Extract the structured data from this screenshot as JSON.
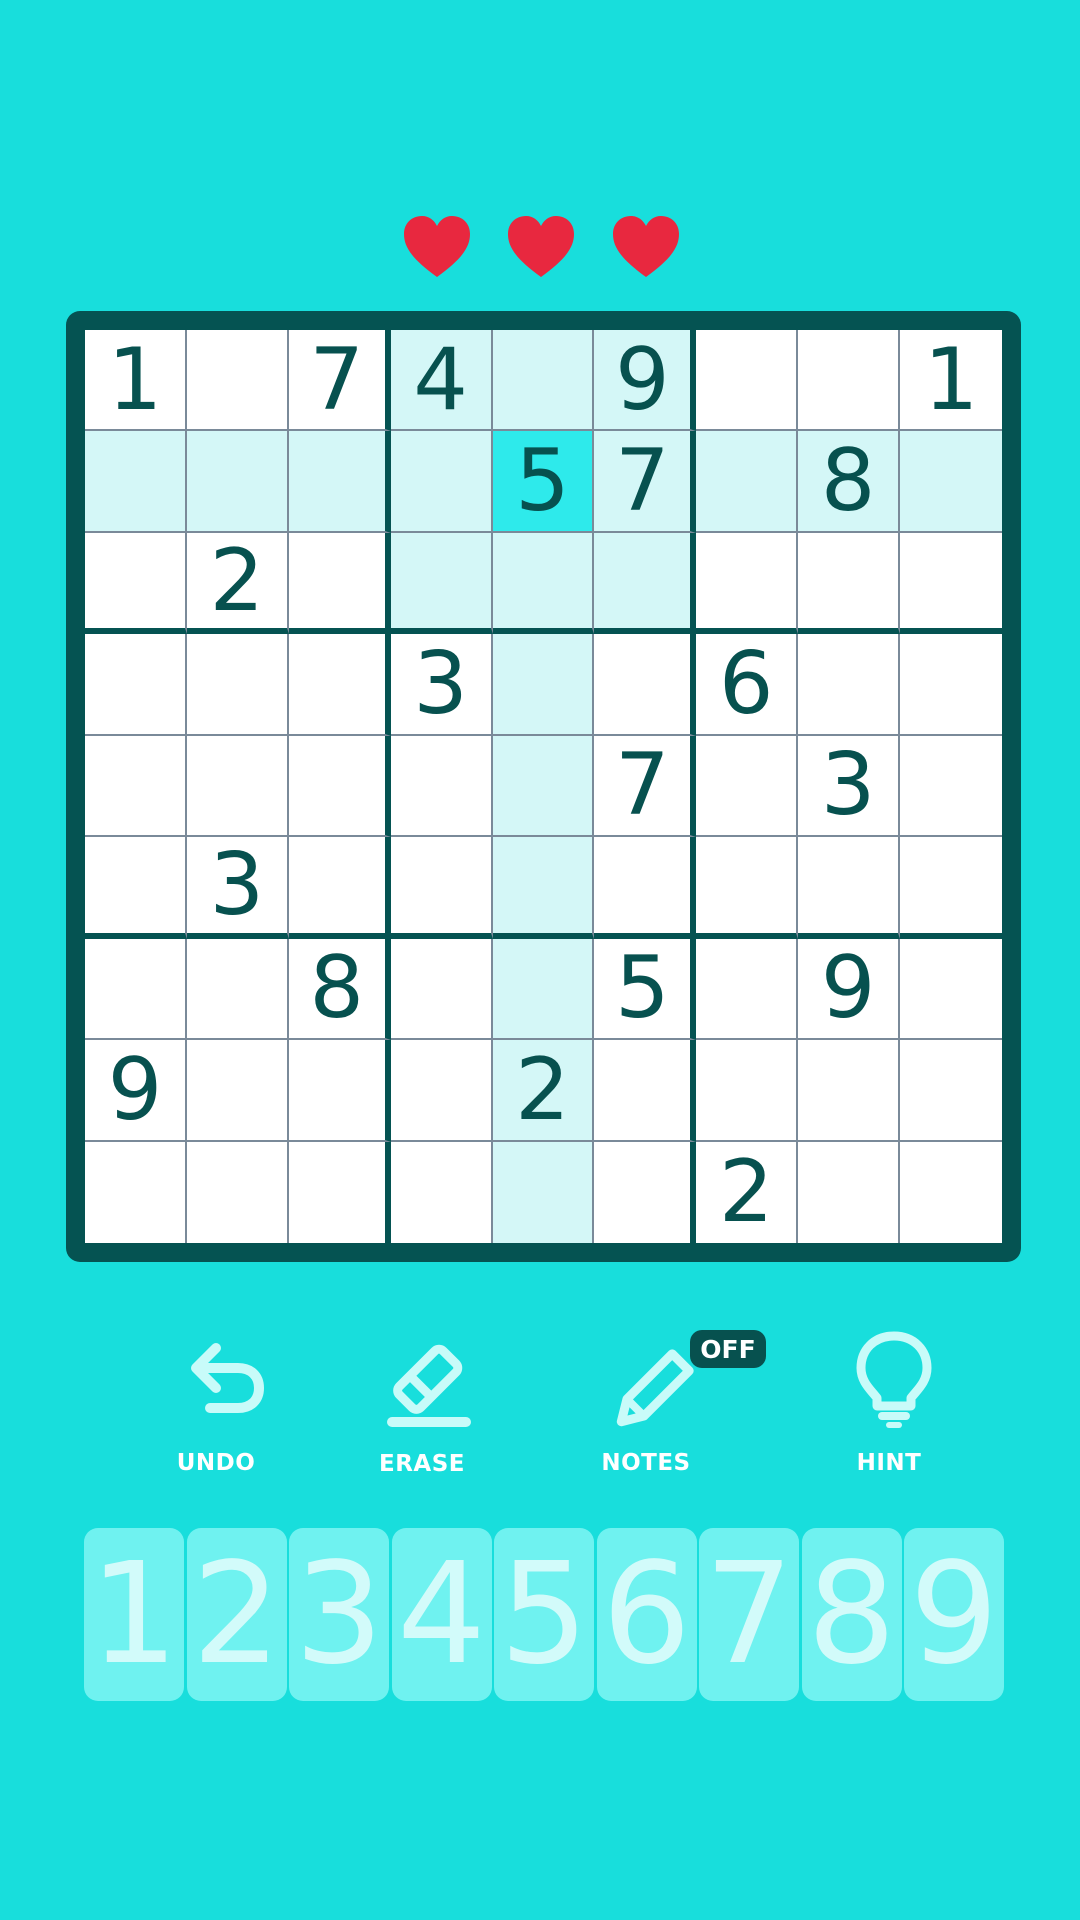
{
  "colors": {
    "background": "#18dedc",
    "board_frame": "#055352",
    "digit": "#07514f",
    "highlight": "#d4f7f7",
    "selected": "#2eeaeb",
    "heart": "#e8283f",
    "tool_icon": "#c8fbf9"
  },
  "lives": {
    "count": 3,
    "hearts": [
      "heart-icon",
      "heart-icon",
      "heart-icon"
    ]
  },
  "selected_cell": {
    "row": 2,
    "col": 5
  },
  "board": [
    [
      "1",
      "",
      "7",
      "4",
      "",
      "9",
      "",
      "",
      "1"
    ],
    [
      "",
      "",
      "",
      "",
      "5",
      "7",
      "",
      "8",
      ""
    ],
    [
      "",
      "2",
      "",
      "",
      "",
      "",
      "",
      "",
      ""
    ],
    [
      "",
      "",
      "",
      "3",
      "",
      "",
      "6",
      "",
      ""
    ],
    [
      "",
      "",
      "",
      "",
      "",
      "7",
      "",
      "3",
      ""
    ],
    [
      "",
      "3",
      "",
      "",
      "",
      "",
      "",
      "",
      ""
    ],
    [
      "",
      "",
      "8",
      "",
      "",
      "5",
      "",
      "9",
      ""
    ],
    [
      "9",
      "",
      "",
      "",
      "2",
      "",
      "",
      "",
      ""
    ],
    [
      "",
      "",
      "",
      "",
      "",
      "",
      "2",
      "",
      ""
    ]
  ],
  "tools": {
    "undo": {
      "label": "UNDO",
      "icon": "undo-arrow-icon"
    },
    "erase": {
      "label": "ERASE",
      "icon": "eraser-icon"
    },
    "notes": {
      "label": "NOTES",
      "icon": "pencil-icon",
      "badge": "OFF"
    },
    "hint": {
      "label": "HINT",
      "icon": "lightbulb-icon"
    }
  },
  "number_pad": [
    "1",
    "2",
    "3",
    "4",
    "5",
    "6",
    "7",
    "8",
    "9"
  ]
}
